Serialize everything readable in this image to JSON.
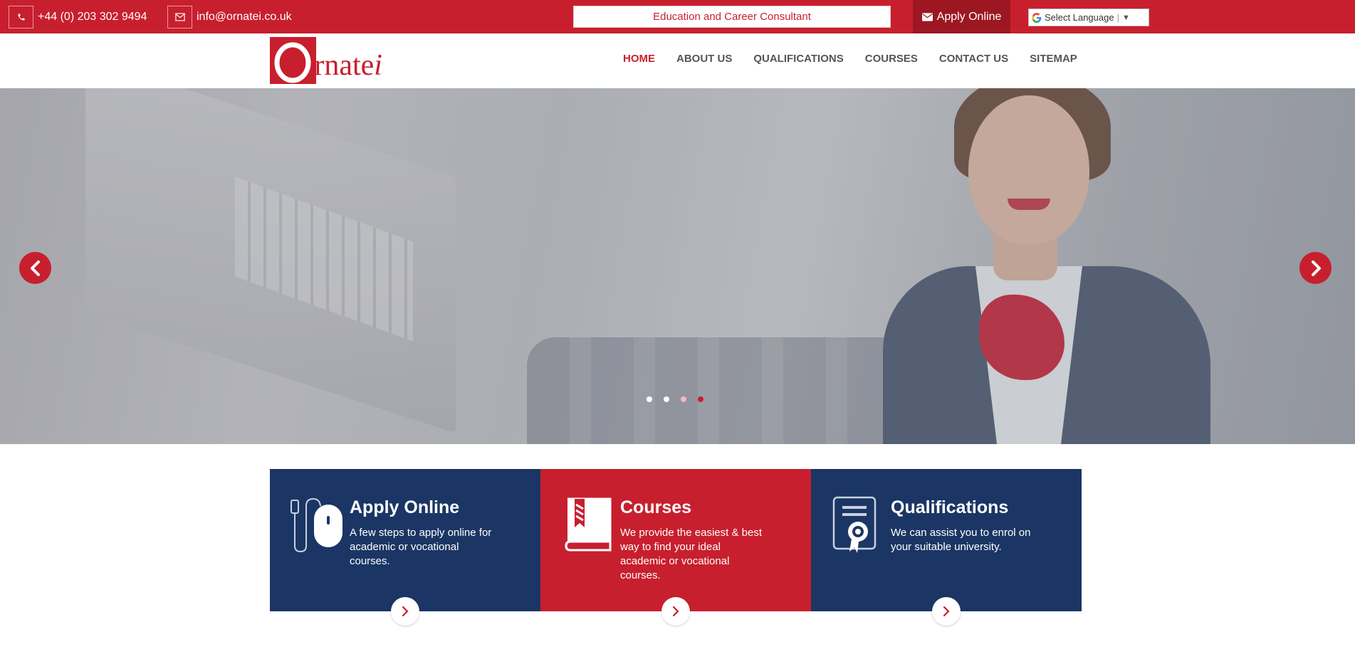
{
  "topbar": {
    "phone": "+44 (0) 203 302 9494",
    "email": "info@ornatei.co.uk",
    "tagline": "Education and Career Consultant",
    "apply_label": "Apply Online",
    "language_label": "Select Language"
  },
  "logo": {
    "brand": "Ornatei"
  },
  "nav": {
    "items": [
      "HOME",
      "ABOUT US",
      "QUALIFICATIONS",
      "COURSES",
      "CONTACT US",
      "SITEMAP"
    ],
    "active": "HOME"
  },
  "slider": {
    "slide_count": 4,
    "active_index": 3
  },
  "features": [
    {
      "title": "Apply Online",
      "description": "A few steps to apply online for academic or vocational courses.",
      "icon": "mouse-icon"
    },
    {
      "title": "Courses",
      "description": "We provide the easiest & best way to find your ideal academic or vocational courses.",
      "icon": "book-icon"
    },
    {
      "title": "Qualifications",
      "description": "We can assist you to enrol on your suitable university.",
      "icon": "certificate-icon"
    }
  ],
  "colors": {
    "brand_red": "#c81f2e",
    "navy": "#1b3664",
    "dark_red": "#9c1722"
  }
}
